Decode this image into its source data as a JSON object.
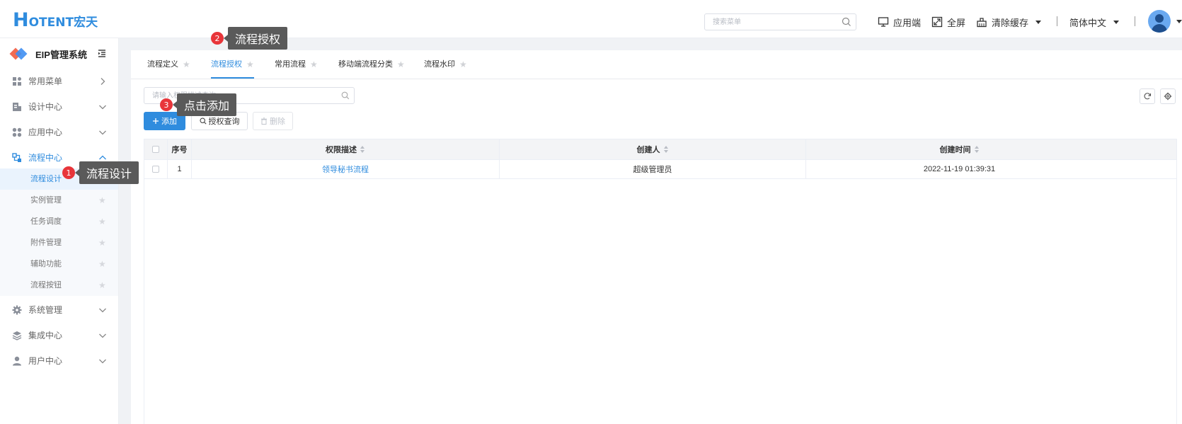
{
  "header": {
    "logo_h": "H",
    "logo_text": "OTENT宏天",
    "search_placeholder": "搜索菜单",
    "app_label": "应用端",
    "fullscreen_label": "全屏",
    "clear_cache_label": "清除缓存",
    "language_label": "简体中文"
  },
  "sidebar": {
    "title": "EIP管理系统",
    "menus": [
      {
        "label": "常用菜单",
        "icon": "grid-icon"
      },
      {
        "label": "设计中心",
        "icon": "design-icon"
      },
      {
        "label": "应用中心",
        "icon": "apps-icon"
      },
      {
        "label": "流程中心",
        "icon": "flow-icon"
      },
      {
        "label": "系统管理",
        "icon": "gear-icon"
      },
      {
        "label": "集成中心",
        "icon": "layers-icon"
      },
      {
        "label": "用户中心",
        "icon": "user-icon"
      }
    ],
    "sub_items": [
      {
        "label": "流程设计"
      },
      {
        "label": "实例管理"
      },
      {
        "label": "任务调度"
      },
      {
        "label": "附件管理"
      },
      {
        "label": "辅助功能"
      },
      {
        "label": "流程按钮"
      }
    ]
  },
  "tabs": [
    {
      "label": "流程定义"
    },
    {
      "label": "流程授权"
    },
    {
      "label": "常用流程"
    },
    {
      "label": "移动端流程分类"
    },
    {
      "label": "流程水印"
    }
  ],
  "toolbar": {
    "search_placeholder": "请输入权限描述查询",
    "add_label": "添加",
    "query_label": "授权查询",
    "delete_label": "删除"
  },
  "table": {
    "columns": {
      "index": "序号",
      "description": "权限描述",
      "creator": "创建人",
      "created_time": "创建时间"
    },
    "rows": [
      {
        "index": "1",
        "description": "领导秘书流程",
        "creator": "超级管理员",
        "created_time": "2022-11-19 01:39:31"
      }
    ]
  },
  "callouts": [
    {
      "num": "1",
      "text": "流程设计"
    },
    {
      "num": "2",
      "text": "流程授权"
    },
    {
      "num": "3",
      "text": "点击添加"
    }
  ],
  "colors": {
    "primary": "#2f8cde",
    "badge": "#e8353a",
    "tooltip": "#5a5a5a"
  }
}
